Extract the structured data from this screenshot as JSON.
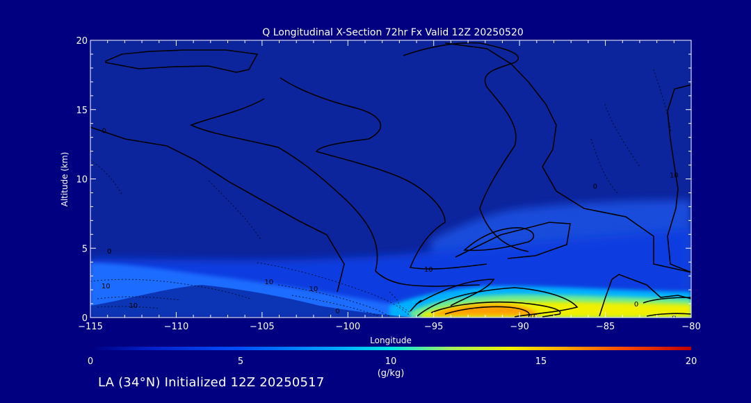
{
  "chart_data": {
    "type": "heatmap",
    "title": "Q Longitudinal X-Section 72hr  Fx Valid 12Z 20250520",
    "xlabel": "Longitude",
    "ylabel": "Altitude (km)",
    "xlim": [
      -115,
      -80
    ],
    "ylim": [
      0,
      20
    ],
    "x_ticks": [
      "−115",
      "−110",
      "−105",
      "−100",
      "−95",
      "−90",
      "−85",
      "−80"
    ],
    "y_ticks": [
      "0",
      "5",
      "10",
      "15",
      "20"
    ],
    "colorbar": {
      "label": "(g/kg)",
      "range": [
        0,
        20
      ],
      "ticks": [
        "0",
        "5",
        "10",
        "15",
        "20"
      ]
    },
    "contour_labels": [
      {
        "text": "0",
        "x": -114.2,
        "y": 13.5
      },
      {
        "text": "0",
        "x": -113.9,
        "y": 4.8
      },
      {
        "text": "10",
        "x": -114.1,
        "y": 2.3
      },
      {
        "text": "10",
        "x": -112.5,
        "y": 0.9
      },
      {
        "text": "10",
        "x": -104.6,
        "y": 2.6
      },
      {
        "text": "10",
        "x": -102.0,
        "y": 2.1
      },
      {
        "text": "0",
        "x": -100.6,
        "y": 0.5
      },
      {
        "text": "10",
        "x": -95.3,
        "y": 3.5
      },
      {
        "text": "10",
        "x": -89.2,
        "y": 0.1
      },
      {
        "text": "0",
        "x": -85.6,
        "y": 9.5
      },
      {
        "text": "0",
        "x": -83.2,
        "y": 1.0
      },
      {
        "text": "0",
        "x": -81.0,
        "y": 0.0
      },
      {
        "text": "10",
        "x": -81.0,
        "y": 10.3
      }
    ],
    "footer": "LA (34°N) Initialized 12Z 20250517"
  },
  "colors": {
    "background": "#000080",
    "field_base": "#0c249c",
    "contour": "#000000",
    "text": "#ffffff",
    "colormap": [
      "#000080",
      "#0020c8",
      "#0050ff",
      "#00a0ff",
      "#00e8e8",
      "#a0f060",
      "#f0f000",
      "#ffb000",
      "#ff5000",
      "#c00000"
    ]
  }
}
